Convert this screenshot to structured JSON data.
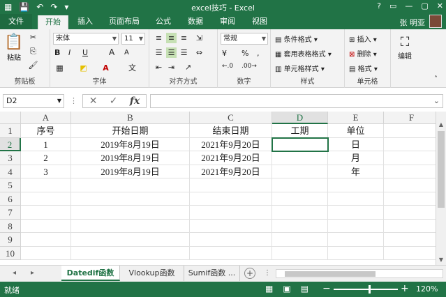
{
  "window": {
    "title": "excel技巧 - Excel",
    "controls": [
      "?",
      "▭",
      "—",
      "▢",
      "✕"
    ]
  },
  "tabs": {
    "file": "文件",
    "items": [
      "开始",
      "插入",
      "页面布局",
      "公式",
      "数据",
      "审阅",
      "视图"
    ],
    "active": "开始",
    "user": "张 明亚"
  },
  "ribbon": {
    "clipboard": {
      "label": "剪贴板",
      "paste": "粘贴"
    },
    "font": {
      "label": "字体",
      "name": "宋体",
      "size": "11",
      "bold": "B",
      "italic": "I",
      "underline": "U",
      "grow": "A",
      "shrink": "A"
    },
    "alignment": {
      "label": "对齐方式"
    },
    "number": {
      "label": "数字",
      "format": "常规",
      "currency": "¥",
      "percent": "%",
      "comma": ","
    },
    "styles": {
      "label": "样式",
      "conditional": "条件格式",
      "table": "套用表格格式",
      "cell": "单元格样式"
    },
    "cells": {
      "label": "单元格",
      "insert": "插入",
      "delete": "删除",
      "format": "格式"
    },
    "editing": {
      "label": "编辑"
    }
  },
  "formula_bar": {
    "name_box": "D2",
    "fx": "fx",
    "value": ""
  },
  "sheet": {
    "columns": [
      "A",
      "B",
      "C",
      "D",
      "E",
      "F"
    ],
    "rows": [
      "1",
      "2",
      "3",
      "4",
      "5",
      "6",
      "7",
      "8",
      "9",
      "10"
    ],
    "cells": [
      [
        "序号",
        "开始日期",
        "结束日期",
        "工期",
        "单位",
        ""
      ],
      [
        "1",
        "2019年8月19日",
        "2021年9月20日",
        "",
        "日",
        ""
      ],
      [
        "2",
        "2019年8月19日",
        "2021年9月20日",
        "",
        "月",
        ""
      ],
      [
        "3",
        "2019年8月19日",
        "2021年9月20日",
        "",
        "年",
        ""
      ]
    ],
    "selected_cell": "D2"
  },
  "sheet_tabs": {
    "items": [
      "Datedif函数",
      "Vlookup函数",
      "Sumif函数 ..."
    ],
    "active": "Datedif函数"
  },
  "status": {
    "ready": "就绪",
    "zoom": "120%"
  }
}
